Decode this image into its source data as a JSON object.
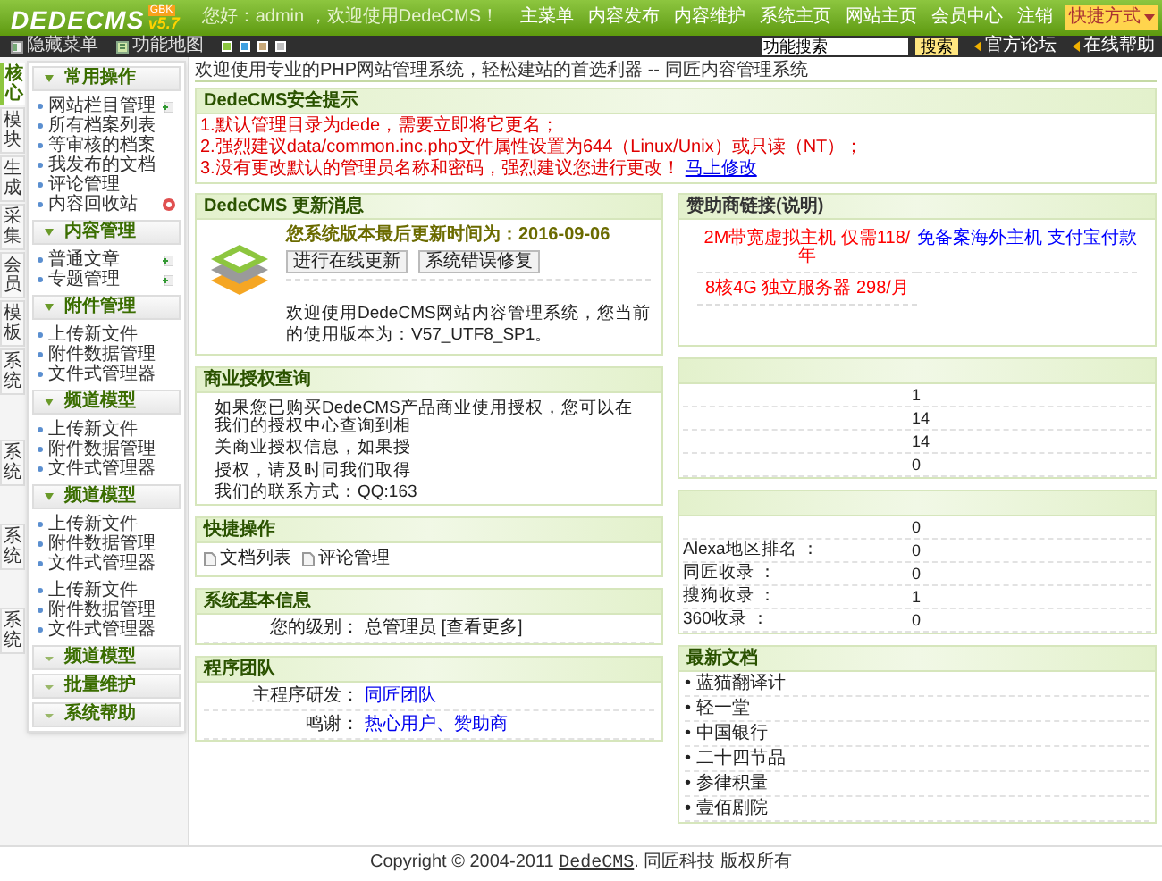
{
  "topbar": {
    "logo": "DEDECMS",
    "version": "v5.7",
    "edition": "GBK",
    "welcome": "您好：admin ，欢迎使用DedeCMS！",
    "nav": [
      "主菜单",
      "内容发布",
      "内容维护",
      "系统主页",
      "网站主页",
      "会员中心",
      "注销"
    ],
    "shortcut": "快捷方式"
  },
  "toolbar": {
    "items": [
      {
        "label": "隐藏菜单",
        "kind": "hide"
      },
      {
        "label": "功能地图",
        "kind": "map"
      }
    ],
    "skins": [
      {
        "color": "#8cc63f"
      },
      {
        "color": "#3ea0e0"
      },
      {
        "color": "#c8a878"
      },
      {
        "color": "#c0c0c0"
      }
    ],
    "search": {
      "value": "功能搜索"
    },
    "search_button": "搜索",
    "links": [
      "官方论坛",
      "在线帮助"
    ]
  },
  "sidebar": {
    "tabs": [
      {
        "label": "核心",
        "selected": true
      },
      {
        "label": "模块",
        "selected": false
      },
      {
        "label": "生成",
        "selected": false
      },
      {
        "label": "采集",
        "selected": false
      },
      {
        "label": "会员",
        "selected": false
      },
      {
        "label": "模板",
        "selected": false
      },
      {
        "label": "系统",
        "selected": false
      },
      {
        "label": "系统",
        "selected": false
      },
      {
        "label": "系统",
        "selected": false
      },
      {
        "label": "系统",
        "selected": false
      }
    ],
    "groups": [
      {
        "title": "常用操作",
        "expanded": true,
        "items": [
          {
            "label": "网站栏目管理",
            "kind": "add"
          },
          {
            "label": "所有档案列表"
          },
          {
            "label": "等审核的档案"
          },
          {
            "label": "我发布的文档"
          },
          {
            "label": "评论管理"
          },
          {
            "label": "内容回收站",
            "kind": "trash"
          }
        ]
      },
      {
        "title": "内容管理",
        "expanded": true,
        "items": [
          {
            "label": "普通文章",
            "kind": "add"
          },
          {
            "label": "专题管理",
            "kind": "add"
          }
        ]
      },
      {
        "title": "附件管理",
        "expanded": true,
        "items": [
          {
            "label": "上传新文件"
          },
          {
            "label": "附件数据管理"
          },
          {
            "label": "文件式管理器"
          }
        ]
      },
      {
        "title": "频道模型",
        "expanded": true,
        "items": [
          {
            "label": "上传新文件"
          },
          {
            "label": "附件数据管理"
          },
          {
            "label": "文件式管理器"
          }
        ]
      },
      {
        "title": "频道模型",
        "expanded": true,
        "items": [
          {
            "label": "上传新文件"
          },
          {
            "label": "附件数据管理"
          },
          {
            "label": "文件式管理器"
          }
        ]
      },
      {
        "items": [
          {
            "label": "上传新文件"
          },
          {
            "label": "附件数据管理"
          },
          {
            "label": "文件式管理器"
          }
        ]
      },
      {
        "title": "频道模型",
        "expanded": false
      },
      {
        "title": "批量维护",
        "expanded": false
      },
      {
        "title": "系统帮助",
        "expanded": false
      }
    ]
  },
  "welcome": "欢迎使用专业的PHP网站管理系统，轻松建站的首选利器 -- 同匠内容管理系统",
  "security": {
    "title": "DedeCMS安全提示",
    "items": [
      {
        "text": "1.默认管理目录为dede，需要立即将它更名；"
      },
      {
        "text": "2.强烈建议data/common.inc.php文件属性设置为644（Linux/Unix）或只读（NT）；"
      },
      {
        "text": "3.没有更改默认的管理员名称和密码，强烈建议您进行更改！",
        "link": "马上修改"
      }
    ]
  },
  "update": {
    "title": "DedeCMS 更新消息",
    "date_line": "您系统版本最后更新时间为：2016-09-06",
    "buttons": [
      "进行在线更新",
      "系统错误修复"
    ],
    "info": "欢迎使用DedeCMS网站内容管理系统，您当前的使用版本为：V57_UTF8_SP1。"
  },
  "license": {
    "title": "商业授权查询",
    "lines": [
      "如果您已购买DedeCMS产品商业使用授权，您可以在我们的授权中心查询到相",
      "关商业授权信息，如果授",
      "授权，请及时同我们取得",
      "我们的联系方式：QQ:163"
    ]
  },
  "quick": {
    "title": "快捷操作",
    "items": [
      {
        "label": "文档列表"
      },
      {
        "label": "评论管理"
      }
    ]
  },
  "sysinfo": {
    "title": "系统基本信息",
    "rows": [
      {
        "label": "您的级别：",
        "value": "总管理员 [查看更多]"
      }
    ]
  },
  "team": {
    "title": "程序团队",
    "rows": [
      {
        "label": "主程序研发：",
        "links": [
          "同匠团队"
        ]
      },
      {
        "label": "鸣谢：",
        "links": [
          "热心用户",
          "赞助商"
        ],
        "separator": "、"
      }
    ]
  },
  "sponsor": {
    "title": "赞助商链接",
    "note": "(说明)",
    "links": [
      {
        "text": "2M带宽虚拟主机 仅需118/年",
        "color": "#ff0000"
      },
      {
        "text": "免备案海外主机 支付宝付款",
        "color": "#0000ff"
      },
      {
        "text": "8核4G 独立服务器 298/月",
        "color": "#ff0000"
      }
    ]
  },
  "stats": {
    "rows": [
      {
        "value": "1"
      },
      {
        "value": "14"
      },
      {
        "value": "14"
      },
      {
        "value": "0"
      }
    ]
  },
  "seo": {
    "rows": [
      {
        "value": "0"
      },
      {
        "label": "Alexa地区排名 ：",
        "value": "0"
      },
      {
        "label": "同匠收录 ：",
        "value": "0"
      },
      {
        "label": "搜狗收录 ：",
        "value": "1"
      },
      {
        "label": "360收录 ：",
        "value": "0"
      }
    ]
  },
  "latest": {
    "title": "最新文档",
    "items": [
      "• 蓝猫翻译计",
      "• 轻一堂",
      "• 中国银行",
      "• 二十四节品",
      "• 参律积量",
      "• 壹佰剧院"
    ]
  },
  "footer": {
    "text": "Copyright © 2004-2011 ",
    "link": "DedeCMS",
    "suffix": ". 同匠科技 版权所有"
  }
}
